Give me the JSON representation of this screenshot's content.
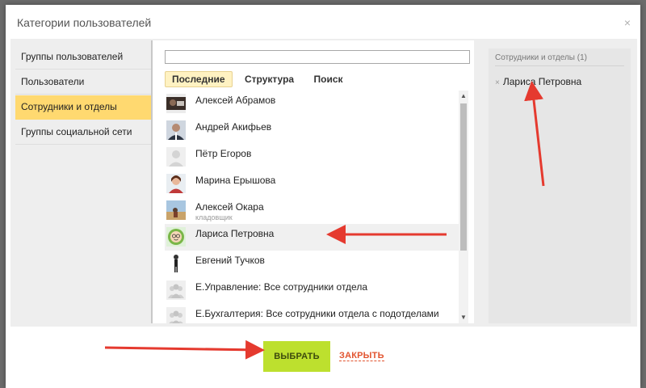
{
  "dialog": {
    "title": "Категории пользователей",
    "close": "×"
  },
  "nav": [
    {
      "label": "Группы пользователей",
      "active": false
    },
    {
      "label": "Пользователи",
      "active": false
    },
    {
      "label": "Сотрудники и отделы",
      "active": true
    },
    {
      "label": "Группы социальной сети",
      "active": false
    }
  ],
  "tabs": [
    {
      "label": "Последние",
      "active": true
    },
    {
      "label": "Структура",
      "active": false
    },
    {
      "label": "Поиск",
      "active": false
    }
  ],
  "list": [
    {
      "name": "Алексей Абрамов",
      "sub": "",
      "avatar": "photo-dark-avatar"
    },
    {
      "name": "Андрей Акифьев",
      "sub": "",
      "avatar": "photo-man-avatar"
    },
    {
      "name": "Пётр Егоров",
      "sub": "",
      "avatar": "default-user-icon"
    },
    {
      "name": "Марина Ерышова",
      "sub": "",
      "avatar": "photo-woman-avatar"
    },
    {
      "name": "Алексей Окара",
      "sub": "кладовщик",
      "avatar": "photo-landscape-avatar"
    },
    {
      "name": "Лариса Петровна",
      "sub": "",
      "avatar": "cartoon-avatar",
      "selected": true
    },
    {
      "name": "Евгений Тучков",
      "sub": "",
      "avatar": "figure-avatar"
    },
    {
      "name": "Е.Управление: Все сотрудники отдела",
      "sub": "",
      "avatar": "group-icon"
    },
    {
      "name": "Е.Бухгалтерия: Все сотрудники отдела с подотделами",
      "sub": "",
      "avatar": "group-icon"
    }
  ],
  "right": {
    "title": "Сотрудники и отделы (1)",
    "selected_remove": "×",
    "selected_name": "Лариса Петровна"
  },
  "buttons": {
    "select": "ВЫБРАТЬ",
    "close": "ЗАКРЫТЬ"
  },
  "colors": {
    "active_nav": "#ffd970",
    "select_button": "#bde02e",
    "close_link": "#e2542f",
    "arrow": "#e53a2f"
  }
}
